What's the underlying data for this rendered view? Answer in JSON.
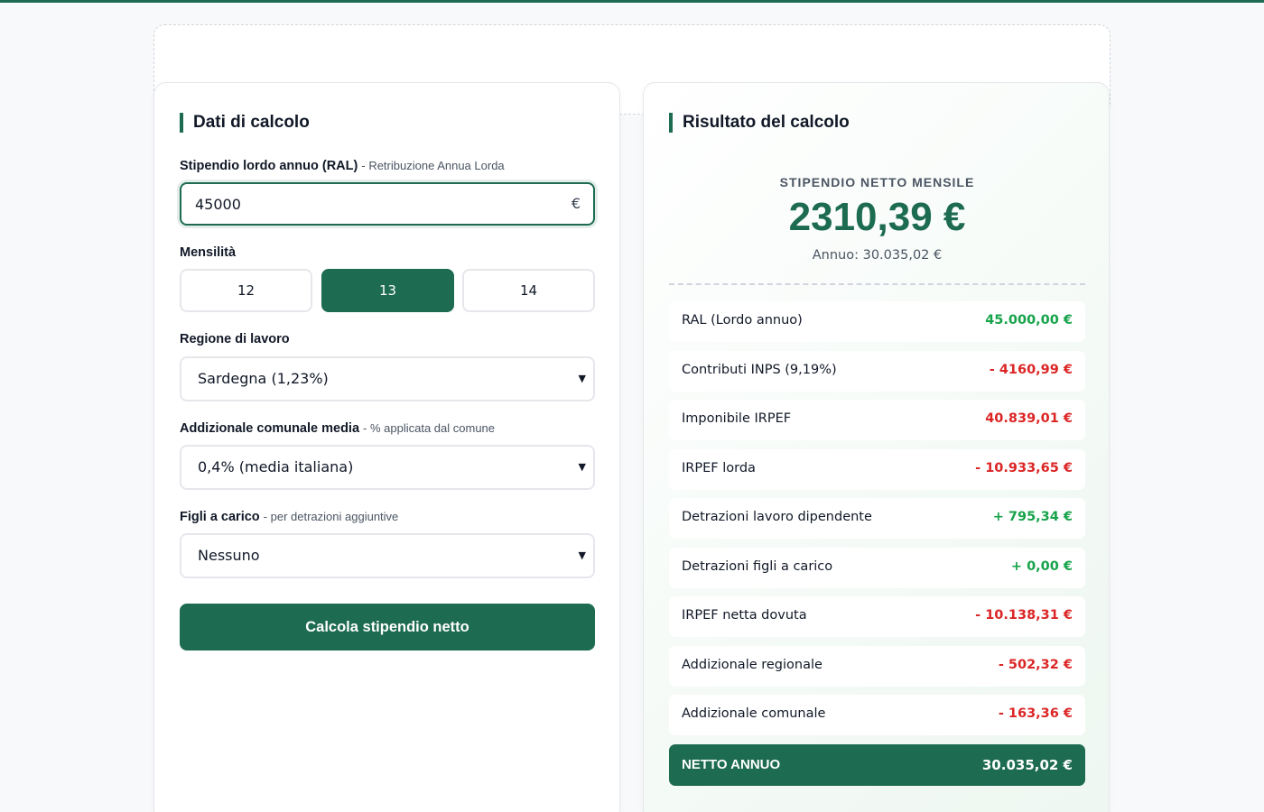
{
  "colors": {
    "accent": "#1d6b50",
    "positive": "#16a34a",
    "negative": "#dc2626"
  },
  "form": {
    "title": "Dati di calcolo",
    "ral": {
      "label": "Stipendio lordo annuo (RAL)",
      "hint": "- Retribuzione Annua Lorda",
      "value": "45000",
      "icon": "euro-icon",
      "icon_glyph": "€"
    },
    "mensilita": {
      "label": "Mensilità",
      "options": [
        "12",
        "13",
        "14"
      ],
      "selected": "13"
    },
    "regione": {
      "label": "Regione di lavoro",
      "value": "Sardegna (1,23%)"
    },
    "addizionale": {
      "label": "Addizionale comunale media",
      "hint": "- % applicata dal comune",
      "value": "0,4% (media italiana)"
    },
    "figli": {
      "label": "Figli a carico",
      "hint": "- per detrazioni aggiuntive",
      "value": "Nessuno"
    },
    "submit_label": "Calcola stipendio netto"
  },
  "result": {
    "title": "Risultato del calcolo",
    "monthly_label": "STIPENDIO NETTO MENSILE",
    "monthly_value": "2310,39 €",
    "annual_text": "Annuo: 30.035,02 €",
    "rows": [
      {
        "label": "RAL (Lordo annuo)",
        "value": "45.000,00 €",
        "sign": "pos"
      },
      {
        "label": "Contributi INPS (9,19%)",
        "value": "- 4160,99 €",
        "sign": "neg"
      },
      {
        "label": "Imponibile IRPEF",
        "value": "40.839,01 €",
        "sign": "neg"
      },
      {
        "label": "IRPEF lorda",
        "value": "- 10.933,65 €",
        "sign": "neg"
      },
      {
        "label": "Detrazioni lavoro dipendente",
        "value": "+ 795,34 €",
        "sign": "pos"
      },
      {
        "label": "Detrazioni figli a carico",
        "value": "+ 0,00 €",
        "sign": "pos"
      },
      {
        "label": "IRPEF netta dovuta",
        "value": "- 10.138,31 €",
        "sign": "neg"
      },
      {
        "label": "Addizionale regionale",
        "value": "- 502,32 €",
        "sign": "neg"
      },
      {
        "label": "Addizionale comunale",
        "value": "- 163,36 €",
        "sign": "neg"
      }
    ],
    "total": {
      "label": "NETTO ANNUO",
      "value": "30.035,02 €"
    }
  }
}
